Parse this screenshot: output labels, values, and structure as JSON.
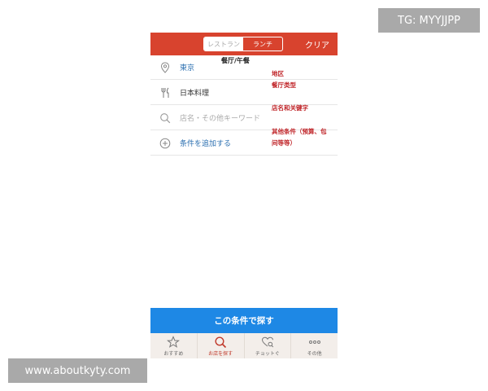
{
  "watermarks": {
    "top": "TG: MYYJJPP",
    "bottom": "www.aboutkyty.com"
  },
  "header": {
    "segments": [
      {
        "label": "レストラン",
        "active": true
      },
      {
        "label": "ランチ",
        "active": false
      }
    ],
    "clear_label": "クリア",
    "color": "#d8432e"
  },
  "criteria": [
    {
      "icon": "location-pin-icon",
      "label": "東京"
    },
    {
      "icon": "fork-knife-icon",
      "label": "日本料理"
    },
    {
      "icon": "search-icon",
      "placeholder": "店名・その他キーワード"
    },
    {
      "icon": "plus-circle-icon",
      "label": "条件を追加する"
    }
  ],
  "annotations": {
    "title": "餐厅/午餐",
    "area": "地区",
    "cuisine": "餐厅类型",
    "keyword": "店名和关键字",
    "other_line1": "其他条件（预算、包",
    "other_line2": "间等等）"
  },
  "search_button": {
    "label": "この条件で探す",
    "color": "#1e88e5"
  },
  "tabbar": [
    {
      "icon": "star-icon",
      "label": "おすすめ",
      "active": false
    },
    {
      "icon": "search-icon",
      "label": "お店を探す",
      "active": true
    },
    {
      "icon": "heart-search-icon",
      "label": "チョットぐ",
      "active": false
    },
    {
      "icon": "more-dots-icon",
      "label": "その他",
      "active": false
    }
  ]
}
